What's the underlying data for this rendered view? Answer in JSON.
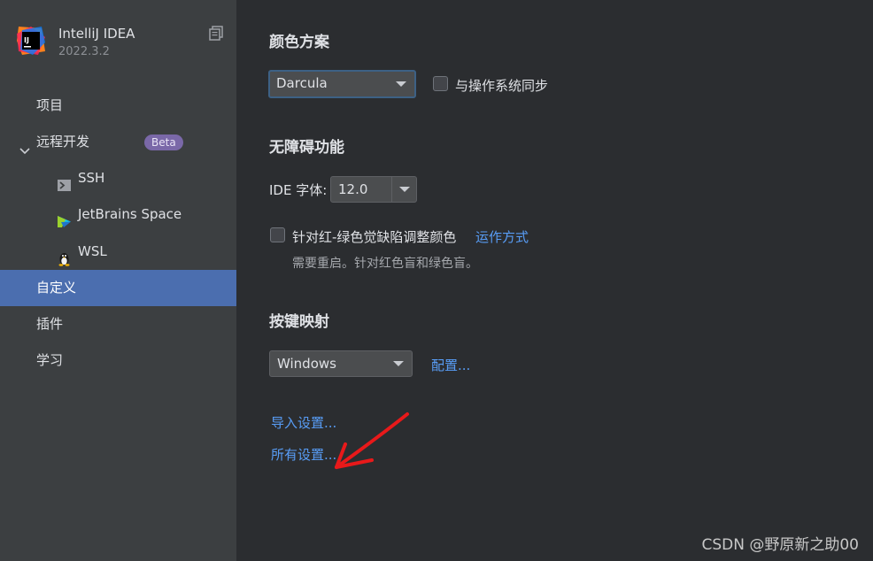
{
  "app": {
    "name": "IntelliJ IDEA",
    "version": "2022.3.2"
  },
  "sidebar": {
    "items": [
      {
        "label": "项目"
      },
      {
        "label": "远程开发",
        "badge": "Beta"
      },
      {
        "label": "自定义"
      },
      {
        "label": "插件"
      },
      {
        "label": "学习"
      }
    ],
    "sub_items": [
      {
        "label": "SSH",
        "icon": "terminal-icon"
      },
      {
        "label": "JetBrains Space",
        "icon": "jetbrains-space-icon"
      },
      {
        "label": "WSL",
        "icon": "linux-penguin-icon"
      }
    ]
  },
  "color_scheme": {
    "title": "颜色方案",
    "selected": "Darcula",
    "sync_label": "与操作系统同步"
  },
  "accessibility": {
    "title": "无障碍功能",
    "ide_font_label": "IDE 字体:",
    "ide_font_value": "12.0",
    "colorblind_label": "针对红-绿色觉缺陷调整颜色",
    "how_it_works_link": "运作方式",
    "hint": "需要重启。针对红色盲和绿色盲。"
  },
  "keymap": {
    "title": "按键映射",
    "selected": "Windows",
    "configure_link": "配置..."
  },
  "links": {
    "import_settings": "导入设置...",
    "all_settings": "所有设置..."
  },
  "watermark": "CSDN @野原新之助00",
  "colors": {
    "accent": "#4b6eaf",
    "link": "#589df6",
    "annotation": "#e8191a"
  }
}
